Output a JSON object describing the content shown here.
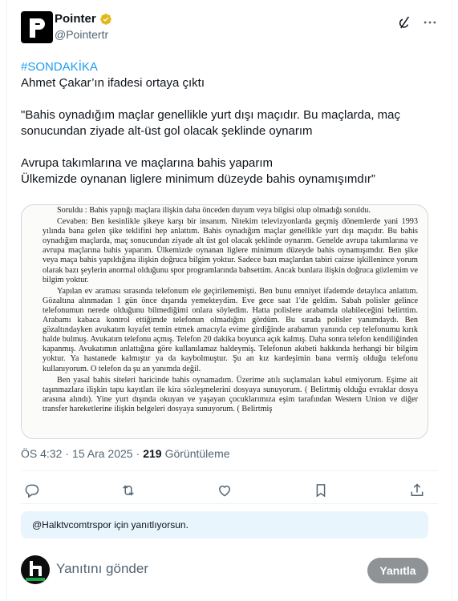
{
  "author": {
    "display_name": "Pointer",
    "handle": "@Pointertr",
    "verified": true,
    "verified_color": "#e2b719",
    "avatar_icon": "pointer-logo-icon"
  },
  "header_icons": [
    "grok-icon",
    "more-icon"
  ],
  "tweet": {
    "hashtag": "#SONDAKİKA",
    "lines": [
      "Ahmet Çakar’ın ifadesi ortaya çıktı",
      "",
      "\"Bahis oynadığım maçlar genellikle yurt dışı maçıdır. Bu maçlarda, maç sonucundan ziyade alt-üst gol olacak şeklinde oynarım",
      "",
      "Avrupa takımlarına ve maçlarına bahis yaparım",
      "Ülkemizde oynanan liglere minimum düzeyde bahis oynamışımdır”"
    ]
  },
  "document": {
    "paragraphs": [
      "Soruldu : Bahis yaptığı maçlara ilişkin daha önceden duyum veya bilgisi olup olmadığı soruldu.",
      "Cevaben: Ben kesinlikle şikeye karşı bir insanım. Nitekim televizyonlarda geçmiş dönemlerde yani 1993 yılında bana gelen şike teklifini hep anlattım. Bahis oynadığım maçlar genellikle yurt dışı maçıdır. Bu bahis oynadığım maçlarda, maç sonucundan ziyade alt üst gol olacak şeklinde oynarım. Genelde avrupa takımlarına ve avrupa maçlarına bahis yaparım. Ülkemizde oynanan liglere minimum düzeyde bahis oynamışımdır. Ben şike veya maça bahis yapıldığına ilişkin doğruca bilgim yoktur. Sadece bazı maçlardan tabiri caizse işkillenince yorum olarak bazı şeylerin anormal olduğunu spor programlarında bahsettim. Ancak bunlara ilişkin doğruca gözlemim ve bilgim yoktur.",
      "Yapılan ev araması sırasında telefonum ele geçirilememişti. Ben bunu emniyet ifademde detaylıca anlattım. Gözaltına alınmadan 1 gün önce dışarıda yemekteydim. Eve gece saat 1'de geldim. Sabah polisler gelince telefonumun nerede olduğunu bilmediğimi onlara söyledim. Hatta polislere arabamda olabileceğini belirttim. Arabamı kabaca kontrol ettiğimde telefonun olmadığını gördüm. Bu sırada polisler yanımdaydı. Ben gözaltındayken avukatım kıyafet temin etmek amacıyla evime girdiğinde arabamın yanında cep telefonumu kırık halde bulmuş. Avukatım telefonu açmış. Telefon 20 dakika boyunca açık kalmış. Daha sonra telefon kendiliğinden kapanmış. Avukatımın anlattığına göre kullanılamaz haldeymiş. Telefonun akıbeti hakkında herhangi bir bilgim yoktur. Ya hastanede kalmıştır ya da kaybolmuştur. Şu an kız kardeşimin bana vermiş olduğu telefonu kullanıyorum. O telefon da şu an yanımda değil.",
      "Ben yasal bahis siteleri haricinde bahis oynamadım. Üzerime atılı suçlamaları kabul etmiyorum. Eşime ait taşınmazlara ilişkin tapu kayıtları ile kira sözleşmelerini dosyaya sunuyorum. ( Belirtmiş olduğu evraklar dosya arasına alındı). Yine yurt dışında okuyan ve yaşayan çocuklarımıza eşim tarafından Western Union ve diğer transfer hareketlerine ilişkin belgeleri dosyaya sunuyorum. ( Belirtmiş"
    ]
  },
  "meta": {
    "time": "ÖS 4:32",
    "sep": "·",
    "date": "15 Ara 2025",
    "views_count": "219",
    "views_label": "Görüntüleme"
  },
  "actions": [
    "reply-icon",
    "retweet-icon",
    "like-icon",
    "bookmark-icon",
    "share-icon"
  ],
  "reply_context": "@Halktvcomtrspor için yanıtlıyorsun.",
  "reply": {
    "placeholder": "Yanıtını gönder",
    "button_label": "Yanıtla",
    "avatar_icon": "halktv-logo-icon"
  },
  "colors": {
    "link": "#1d9bf0",
    "text": "#0f1419",
    "secondary": "#536471",
    "reply_button": "#8f9396",
    "reply_context_bg": "#e8f5fd"
  }
}
